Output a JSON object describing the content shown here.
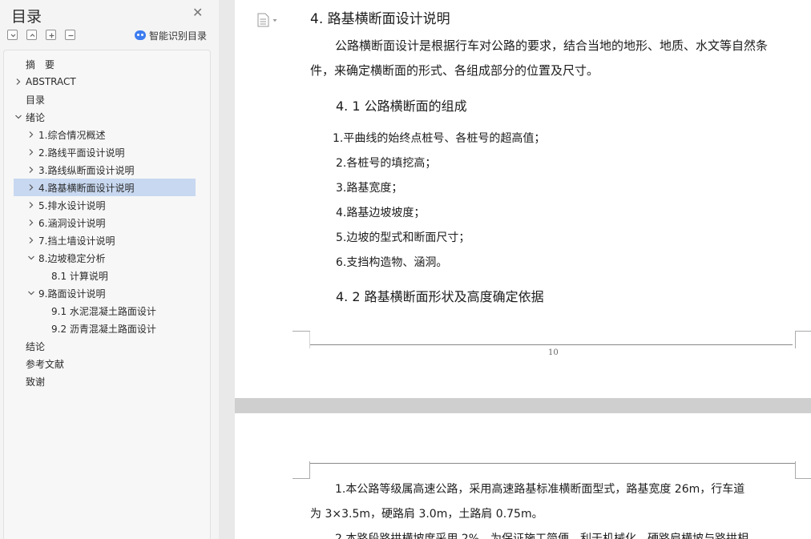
{
  "sidebar": {
    "title": "目录",
    "ai_label": "智能识别目录",
    "toc": [
      {
        "label": "摘　要",
        "level": 0,
        "arrow": "none"
      },
      {
        "label": "ABSTRACT",
        "level": 0,
        "arrow": "right"
      },
      {
        "label": "目录",
        "level": 0,
        "arrow": "none"
      },
      {
        "label": "绪论",
        "level": 0,
        "arrow": "down"
      },
      {
        "label": "1.综合情况概述",
        "level": 1,
        "arrow": "right"
      },
      {
        "label": "2.路线平面设计说明",
        "level": 1,
        "arrow": "right"
      },
      {
        "label": "3.路线纵断面设计说明",
        "level": 1,
        "arrow": "right"
      },
      {
        "label": "4.路基横断面设计说明",
        "level": 1,
        "arrow": "right",
        "selected": true
      },
      {
        "label": "5.排水设计说明",
        "level": 1,
        "arrow": "right"
      },
      {
        "label": "6.涵洞设计说明",
        "level": 1,
        "arrow": "right"
      },
      {
        "label": "7.挡土墙设计说明",
        "level": 1,
        "arrow": "right"
      },
      {
        "label": "8.边坡稳定分析",
        "level": 1,
        "arrow": "down"
      },
      {
        "label": "8.1 计算说明",
        "level": 2,
        "arrow": "none"
      },
      {
        "label": "9.路面设计说明",
        "level": 1,
        "arrow": "down"
      },
      {
        "label": "9.1  水泥混凝土路面设计",
        "level": 2,
        "arrow": "none"
      },
      {
        "label": "9.2  沥青混凝土路面设计",
        "level": 2,
        "arrow": "none"
      },
      {
        "label": "结论",
        "level": 0,
        "arrow": "none"
      },
      {
        "label": "参考文献",
        "level": 0,
        "arrow": "none"
      },
      {
        "label": "致谢",
        "level": 0,
        "arrow": "none"
      }
    ]
  },
  "page1": {
    "heading": "4. 路基横断面设计说明",
    "para_line1": "公路横断面设计是根据行车对公路的要求，结合当地的地形、地质、水文等自然条",
    "para_line2": "件，来确定横断面的形式、各组成部分的位置及尺寸。",
    "section_41": "4. 1  公路横断面的组成",
    "items": [
      "1.平曲线的始终点桩号、各桩号的超高值；",
      "2.各桩号的填挖高；",
      "3.路基宽度；",
      "4.路基边坡坡度；",
      "5.边坡的型式和断面尺寸；",
      "6.支挡构造物、涵洞。"
    ],
    "section_42": "4. 2  路基横断面形状及高度确定依据",
    "page_number": "10"
  },
  "page2": {
    "line1": "1.本公路等级属高速公路，采用高速路基标准横断面型式，路基宽度 26m，行车道",
    "line2": "为 3×3.5m，硬路肩 3.0m，土路肩 0.75m。",
    "line3": "2.本路段路拱横坡度采用 2%，为保证施工简便，利于机械化，硬路肩横坡与路拱相"
  }
}
